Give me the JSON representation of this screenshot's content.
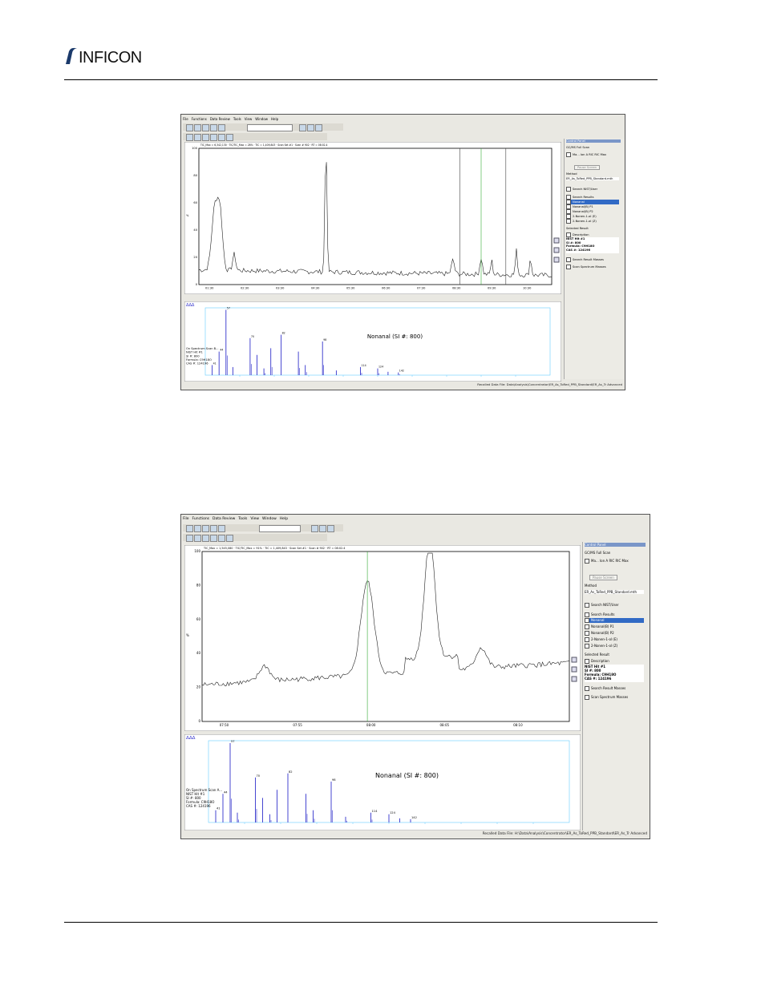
{
  "header": {
    "logo_text": "INFICON"
  },
  "screenshots": [
    {
      "menu": [
        "File",
        "Functions",
        "Data Review",
        "Tools",
        "View",
        "Window",
        "Help"
      ],
      "chrom_title": "TIC_Max = 6,342,130 · TIC/TIC_Max = 28% · TIC = 1,409,843 · Scan Set #1 · Scan # 902 · RT = 08:02.4",
      "chrom_y_axis_label": "%",
      "chrom_y_ticks": [
        "0",
        "20",
        "40",
        "60",
        "80",
        "100"
      ],
      "chrom_x_ticks": [
        "01:30",
        "02:30",
        "03:30",
        "04:30",
        "05:30",
        "06:30",
        "07:30",
        "08:30",
        "09:30",
        "10:30"
      ],
      "spectrum_title": "Nonanal (SI #: 800)",
      "spectrum_info": [
        "On Spectrum Scan B...",
        "NIST Hit #1",
        "SI #: 800",
        "Formula: C9H18O",
        "CAS #: 124196"
      ],
      "spectrum_peak_labels": [
        "41",
        "44",
        "57",
        "70",
        "82",
        "98",
        "114",
        "124",
        "142"
      ],
      "side": {
        "title": "Control Panel",
        "mode": "GC/MS Full Scan",
        "cols": [
          "Ma...",
          "Ion A",
          "RIC",
          "RIC Max"
        ],
        "pause_button": "Pause Screen",
        "method_label": "Method",
        "method_value": "ER_As_ToRed_PPB_Standard.mth",
        "search_nist": "Search NIST/User",
        "search_results_label": "Search Results",
        "results": [
          "Nonanal",
          "Nonanal(B) P1",
          "Nonanal(B) P2",
          "2-Nonen-1-ol (E)",
          "2-Nonen-1-ol (Z)"
        ],
        "selected_result_label": "Selected Result",
        "description": "Description",
        "desc_lines": [
          "NIST Hit #1",
          "SI #: 800",
          "Formula: C9H18O",
          "CAS #: 124196"
        ],
        "opt1": "Search Result Masses",
        "opt2": "Scan Spectrum Masses"
      },
      "status": "Recalled Data File: Data\\Analysis\\Concentrator\\ER_As_ToRed_PPB_Standard\\ER_As_Tr Advanced"
    },
    {
      "menu": [
        "File",
        "Functions",
        "Data Review",
        "Tools",
        "View",
        "Window",
        "Help"
      ],
      "chrom_title": "TIC_Max = 1,545,080 · TIC/TIC_Max = 91% · TIC = 1,409,843 · Scan Set #1 · Scan # 902 · RT = 08:02.4",
      "chrom_y_axis_label": "%",
      "chrom_y_ticks": [
        "0",
        "20",
        "40",
        "60",
        "80",
        "100"
      ],
      "chrom_x_ticks": [
        "07:50",
        "07:55",
        "08:00",
        "08:05",
        "08:10"
      ],
      "spectrum_title": "Nonanal (SI #: 800)",
      "spectrum_info": [
        "On Spectrum Scan A...",
        "NIST Hit #1",
        "SI #: 800",
        "Formula: C9H18O",
        "CAS #: 124196"
      ],
      "spectrum_peak_labels": [
        "41",
        "44",
        "57",
        "70",
        "82",
        "98",
        "114",
        "124",
        "142"
      ],
      "side": {
        "title": "Control Panel",
        "mode": "GC/MS Full Scan",
        "cols": [
          "Ma...",
          "Ion A",
          "RIC",
          "RIC Max"
        ],
        "pause_button": "Pause Screen",
        "method_label": "Method",
        "method_value": "ER_As_ToRed_PPB_Standard.mth",
        "search_nist": "Search NIST/User",
        "search_results_label": "Search Results",
        "results": [
          "Nonanal",
          "Nonanal(B) P1",
          "Nonanal(B) P2",
          "2-Nonen-1-ol (E)",
          "2-Nonen-1-ol (Z)"
        ],
        "selected_result_label": "Selected Result",
        "description": "Description",
        "desc_lines": [
          "NIST Hit #1",
          "SI #: 800",
          "Formula: C9H18O",
          "CAS #: 124196"
        ],
        "opt1": "Search Result Masses",
        "opt2": "Scan Spectrum Masses"
      },
      "status": "Recalled Data File: H:\\Data\\Analysis\\Concentrator\\ER_As_ToRed_PPB_Standard\\ER_As_Tr Advanced"
    }
  ]
}
